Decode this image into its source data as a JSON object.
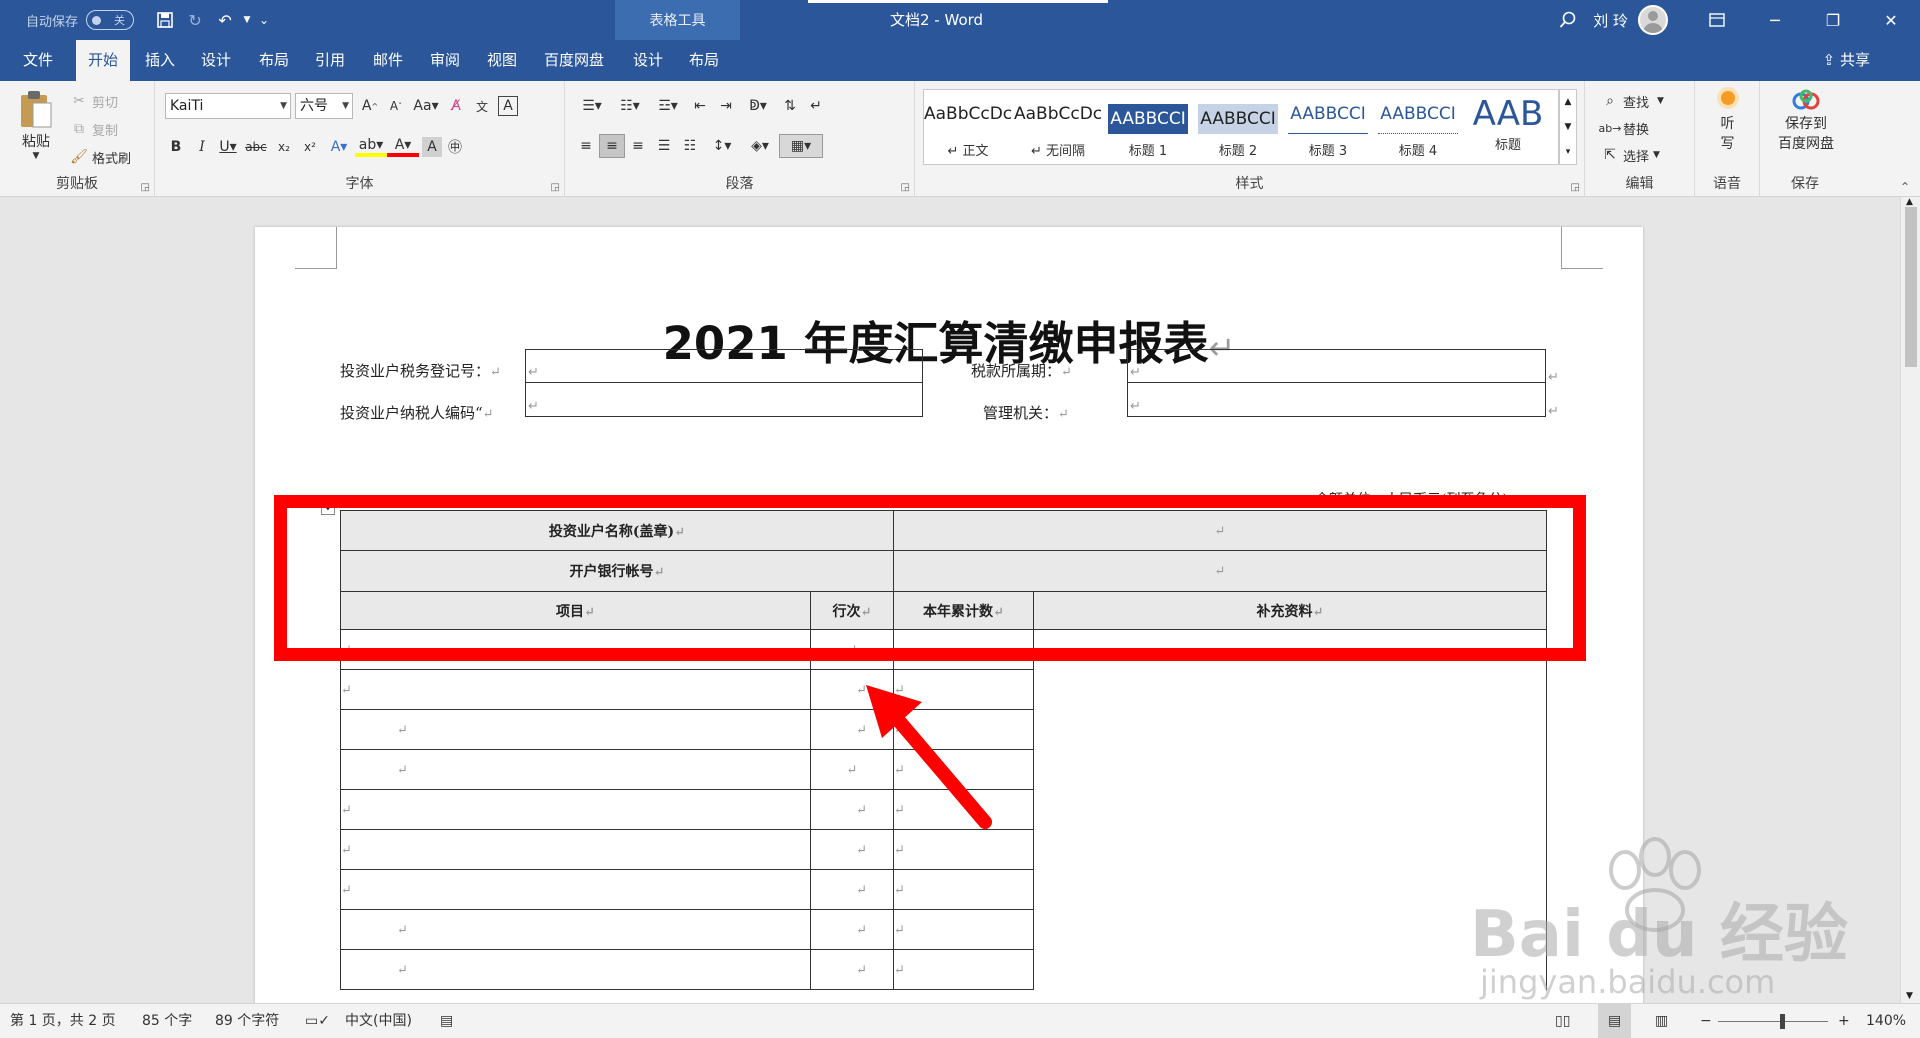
{
  "titlebar": {
    "autosave_label": "自动保存",
    "autosave_state": "关",
    "table_tools": "表格工具",
    "document_title": "文档2 - Word",
    "user_name": "刘 玲"
  },
  "tabs": {
    "file": "文件",
    "home": "开始",
    "insert": "插入",
    "design": "设计",
    "layout": "布局",
    "references": "引用",
    "mailings": "邮件",
    "review": "审阅",
    "view": "视图",
    "baidu": "百度网盘",
    "table_design": "设计",
    "table_layout": "布局",
    "share": "共享"
  },
  "ribbon": {
    "clipboard": {
      "label": "剪贴板",
      "paste": "粘贴",
      "cut": "剪切",
      "copy": "复制",
      "format_painter": "格式刷"
    },
    "font": {
      "label": "字体",
      "font_name": "KaiTi",
      "font_size": "六号"
    },
    "paragraph": {
      "label": "段落"
    },
    "styles": {
      "label": "样式",
      "items": [
        {
          "sample": "AaBbCcDc",
          "name": "↵ 正文"
        },
        {
          "sample": "AaBbCcDc",
          "name": "↵ 无间隔"
        },
        {
          "sample": "AABBCCI",
          "name": "标题 1"
        },
        {
          "sample": "AABBCCI",
          "name": "标题 2"
        },
        {
          "sample": "AABBCCI",
          "name": "标题 3"
        },
        {
          "sample": "AABBCCI",
          "name": "标题 4"
        },
        {
          "sample": "AAB",
          "name": "标题"
        }
      ]
    },
    "editing": {
      "label": "编辑",
      "find": "查找",
      "replace": "替换",
      "select": "选择"
    },
    "voice": {
      "label": "语音",
      "dictate_1": "听",
      "dictate_2": "写"
    },
    "save": {
      "label": "保存",
      "save_to_1": "保存到",
      "save_to_2": "百度网盘"
    }
  },
  "document": {
    "title": "2021 年度汇算清缴申报表",
    "tax_reg_label": "投资业户税务登记号：",
    "tax_period_label": "税款所属期：",
    "taxpayer_code_label": "投资业户纳税人编码“",
    "tax_authority_label": "管理机关：",
    "amount_unit": "金额单位：人民币元(列至角分)",
    "table": {
      "name_label": "投资业户名称(盖章)",
      "bank_label": "开户银行帐号",
      "col_item": "项目",
      "col_line": "行次",
      "col_ytd": "本年累计数",
      "col_supp": "补充资料"
    }
  },
  "watermark": {
    "brand": "Bai du 经验",
    "url": "jingyan.baidu.com"
  },
  "statusbar": {
    "page": "第 1 页，共 2 页",
    "words": "85 个字",
    "chars": "89 个字符",
    "language": "中文(中国)",
    "zoom": "140%"
  },
  "colors": {
    "word_blue": "#2b579a",
    "highlight_red": "#ff0000",
    "table_shade": "#e9e9e9"
  }
}
